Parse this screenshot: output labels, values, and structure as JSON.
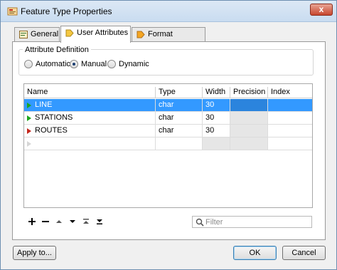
{
  "window": {
    "title": "Feature Type Properties",
    "close_glyph": "x"
  },
  "tabs": [
    {
      "label": "General",
      "icon": "general-icon",
      "active": false
    },
    {
      "label": "User Attributes",
      "icon": "attributes-icon",
      "active": true
    },
    {
      "label": "Format Attributes",
      "icon": "format-attributes-icon",
      "active": false
    }
  ],
  "attribute_definition": {
    "legend": "Attribute Definition",
    "options": [
      {
        "label": "Automatic",
        "checked": false
      },
      {
        "label": "Manual",
        "checked": true
      },
      {
        "label": "Dynamic",
        "checked": false
      }
    ]
  },
  "table": {
    "columns": [
      "Name",
      "Type",
      "Width",
      "Precision",
      "Index"
    ],
    "rows": [
      {
        "name": "LINE",
        "type": "char",
        "width": "30",
        "precision": "",
        "index": "",
        "marker_color": "#1ba51b",
        "selected": true
      },
      {
        "name": "STATIONS",
        "type": "char",
        "width": "30",
        "precision": "",
        "index": "",
        "marker_color": "#1ba51b",
        "selected": false
      },
      {
        "name": "ROUTES",
        "type": "char",
        "width": "30",
        "precision": "",
        "index": "",
        "marker_color": "#c4261c",
        "selected": false
      },
      {
        "name": "",
        "type": "",
        "width": "",
        "precision": "",
        "index": "",
        "marker_color": "#d6d6d6",
        "selected": false
      }
    ]
  },
  "toolbar": {
    "icons": [
      "add-icon",
      "remove-icon",
      "move-up-icon",
      "move-down-icon",
      "move-to-top-icon",
      "move-to-bottom-icon"
    ]
  },
  "filter": {
    "placeholder": "Filter",
    "value": ""
  },
  "buttons": {
    "apply_to": "Apply to...",
    "ok": "OK",
    "cancel": "Cancel"
  },
  "colors": {
    "selection": "#3399ff",
    "green_marker": "#1ba51b",
    "red_marker": "#c4261c"
  }
}
